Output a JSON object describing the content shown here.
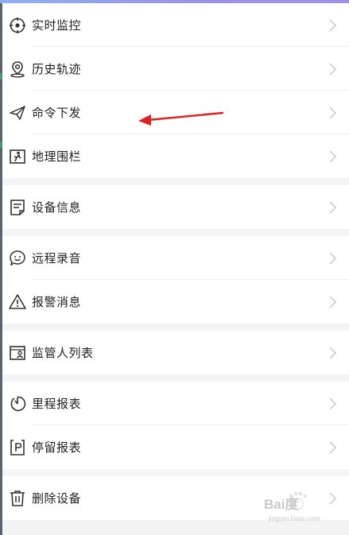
{
  "menu": {
    "items": [
      {
        "label": "实时监控",
        "icon": "target-icon"
      },
      {
        "label": "历史轨迹",
        "icon": "map-pin-icon"
      },
      {
        "label": "命令下发",
        "icon": "send-icon"
      },
      {
        "label": "地理围栏",
        "icon": "fence-icon"
      },
      {
        "label": "设备信息",
        "icon": "document-icon"
      },
      {
        "label": "远程录音",
        "icon": "smiley-chat-icon"
      },
      {
        "label": "报警消息",
        "icon": "warning-icon"
      },
      {
        "label": "监管人列表",
        "icon": "person-card-icon"
      },
      {
        "label": "里程报表",
        "icon": "timer-icon"
      },
      {
        "label": "停留报表",
        "icon": "parking-icon"
      },
      {
        "label": "删除设备",
        "icon": "trash-icon"
      }
    ]
  },
  "annotation": {
    "arrow_color": "#e02020",
    "points_to": "命令下发"
  },
  "watermark": {
    "text": "Bai度",
    "url": "jingyan.baidu.com"
  },
  "colors": {
    "text": "#222222",
    "icon": "#333333",
    "chevron": "#c8c8c8",
    "section_gap": "#f4f4f4"
  }
}
